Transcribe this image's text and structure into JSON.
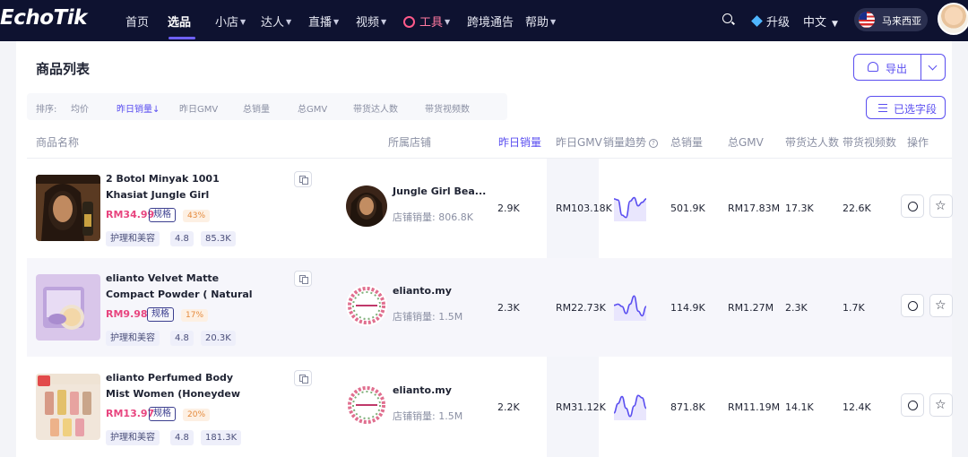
{
  "nav": {
    "logo": "EchoTik",
    "items": [
      "首页",
      "选品",
      "小店",
      "达人",
      "直播",
      "视频"
    ],
    "tools_label": "工具",
    "items_after": [
      "跨境通告",
      "帮助"
    ],
    "upgrade": "升级",
    "language": "中文",
    "region": "马来西亚"
  },
  "page": {
    "title": "商品列表",
    "export_label": "导出",
    "fields_label": "已选字段"
  },
  "sortbar": {
    "label": "排序:",
    "items": [
      "均价",
      "昨日销量↓",
      "昨日GMV",
      "总销量",
      "总GMV",
      "带货达人数",
      "带货视频数"
    ]
  },
  "table": {
    "headers": [
      "商品名称",
      "所属店铺",
      "昨日销量",
      "昨日GMV",
      "销量趋势",
      "总销量",
      "总GMV",
      "带货达人数",
      "带货视频数",
      "操作"
    ],
    "rows": [
      {
        "name": "2 Botol Minyak 1001 Khasiat Jungle Girl Massage Oil",
        "price": "RM34.99",
        "spec": "规格",
        "pct": "43%",
        "tags": [
          "护理和美容",
          "4.8",
          "85.3K"
        ],
        "shop_name": "Jungle Girl Bea...",
        "shop_sales": "店铺销量: 806.8K",
        "yesterday_sales": "2.9K",
        "yesterday_gmv": "RM103.18K",
        "total_sales": "501.9K",
        "total_gmv": "RM17.83M",
        "creators": "17.3K",
        "videos": "22.6K",
        "trend": [
          0.85,
          0.8,
          0.15,
          0.05,
          0.75,
          0.9,
          0.55,
          0.7,
          0.85
        ]
      },
      {
        "name": "elianto Velvet Matte Compact Powder ( Natural coverage,…",
        "price": "RM9.98",
        "spec": "规格",
        "pct": "17%",
        "tags": [
          "护理和美容",
          "4.8",
          "20.3K"
        ],
        "shop_name": "elianto.my",
        "shop_sales": "店铺销量: 1.5M",
        "yesterday_sales": "2.3K",
        "yesterday_gmv": "RM22.73K",
        "total_sales": "114.9K",
        "total_gmv": "RM1.27M",
        "creators": "2.3K",
        "videos": "1.7K",
        "trend": [
          0.55,
          0.6,
          0.5,
          0.2,
          0.6,
          0.95,
          0.3,
          0.1,
          0.5
        ]
      },
      {
        "name": "elianto Perfumed Body Mist Women (Honeydew /Coconu…",
        "price": "RM13.97",
        "spec": "规格",
        "pct": "20%",
        "tags": [
          "护理和美容",
          "4.8",
          "181.3K"
        ],
        "shop_name": "elianto.my",
        "shop_sales": "店铺销量: 1.5M",
        "yesterday_sales": "2.2K",
        "yesterday_gmv": "RM31.12K",
        "total_sales": "871.8K",
        "total_gmv": "RM11.19M",
        "creators": "14.1K",
        "videos": "12.4K",
        "trend": [
          0.2,
          0.6,
          0.9,
          0.4,
          0.05,
          0.5,
          0.95,
          0.85,
          0.4
        ]
      }
    ]
  },
  "colors": {
    "nav_bg": "#0e1230",
    "accent": "#5a4ef0",
    "price": "#e8457f",
    "trend_line": "#5a4ef0"
  }
}
